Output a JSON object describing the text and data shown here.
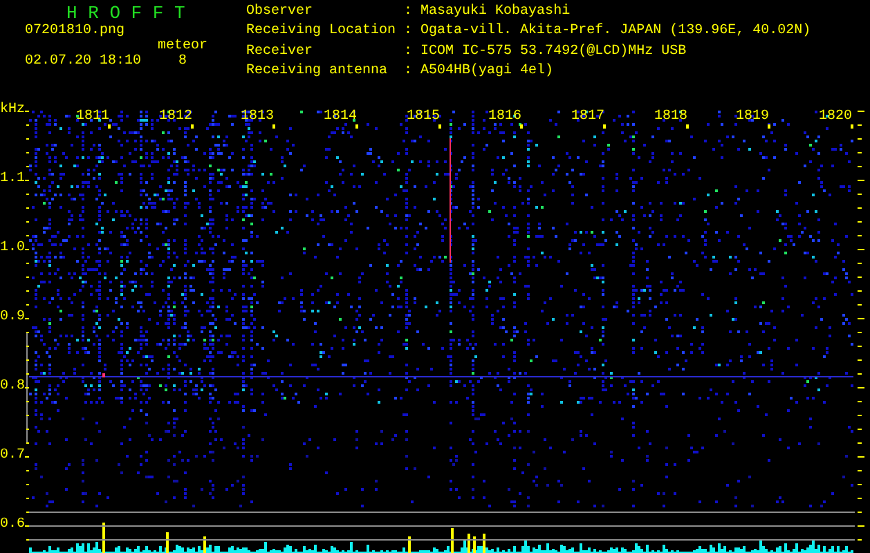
{
  "header": {
    "title": "H R O F F T",
    "filename": "07201810.png",
    "datetime": "02.07.20 18:10",
    "meteor_label": "meteor",
    "meteor_count": "8"
  },
  "info": [
    {
      "label": "Observer",
      "separator": ":",
      "value": "Masayuki Kobayashi"
    },
    {
      "label": "Receiving Location",
      "separator": ":",
      "value": "Ogata-vill. Akita-Pref. JAPAN (139.96E, 40.02N)"
    },
    {
      "label": "Receiver",
      "separator": ":",
      "value": "ICOM IC-575 53.7492(@LCD)MHz USB"
    },
    {
      "label": "Receiving antenna",
      "separator": ":",
      "value": "A504HB(yagi 4el)"
    }
  ],
  "time_axis": [
    "1811",
    "1812",
    "1813",
    "1814",
    "1815",
    "1816",
    "1817",
    "1818",
    "1819",
    "1820"
  ],
  "freq_axis": {
    "unit": "kHz",
    "labels": [
      "1.1",
      "1.0",
      "0.9",
      "0.8",
      "0.7",
      "0.6"
    ]
  }
}
